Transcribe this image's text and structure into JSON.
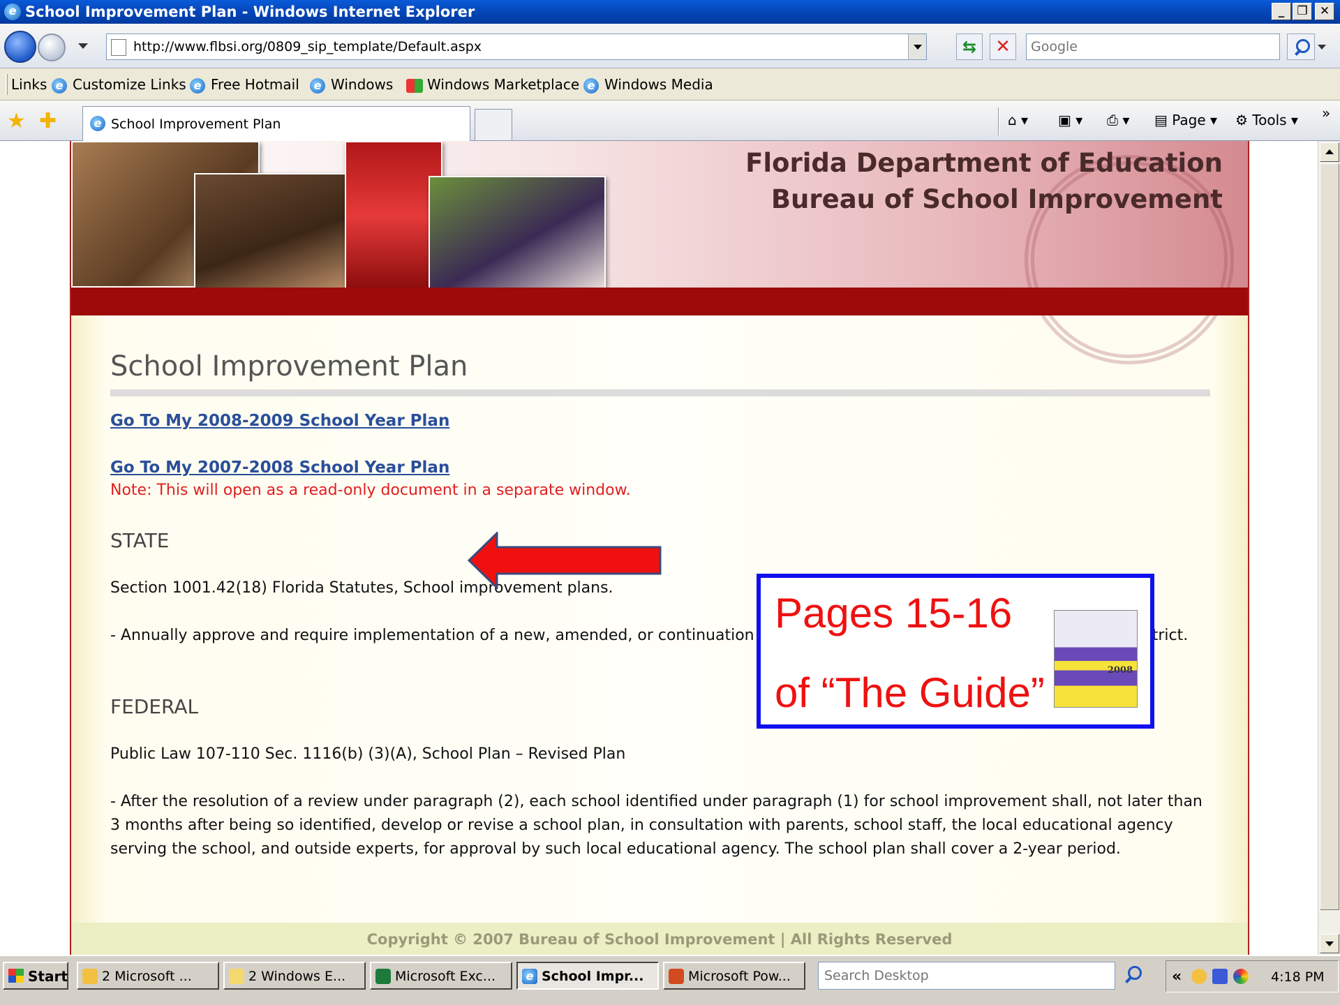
{
  "window": {
    "title": "School Improvement Plan - Windows Internet Explorer",
    "minimize": "_",
    "restore": "❐",
    "close": "✕"
  },
  "address_bar": {
    "url": "http://www.flbsi.org/0809_sip_template/Default.aspx",
    "search_placeholder": "Google"
  },
  "links_bar": {
    "label": "Links",
    "items": [
      "Customize Links",
      "Free Hotmail",
      "Windows",
      "Windows Marketplace",
      "Windows Media"
    ]
  },
  "tab_bar": {
    "active_tab": "School Improvement Plan",
    "page_menu": "Page",
    "tools_menu": "Tools",
    "more": "»"
  },
  "banner": {
    "org_line1": "Florida Department of Education",
    "org_line2": "Bureau of School Improvement"
  },
  "content": {
    "page_title": "School Improvement Plan",
    "link_2008": "Go To My 2008-2009 School Year Plan",
    "link_2007": "Go To My 2007-2008 School Year Plan",
    "note": "Note: This will open as a read-only document in a separate window.",
    "state_heading": "STATE",
    "state_citation": "Section 1001.42(18) Florida Statutes, School improvement plans.",
    "state_text": "- Annually approve and require implementation of a new, amended, or continuation school improvement plan for each school in the district.",
    "federal_heading": "FEDERAL",
    "federal_citation": "Public Law 107-110 Sec. 1116(b) (3)(A), School Plan – Revised Plan",
    "federal_text": "- After the resolution of a review under paragraph (2), each school identified under paragraph (1) for school improvement shall, not later than 3 months after being so identified, develop or revise a school plan, in consultation with parents, school staff, the local educational agency serving the school, and outside experts, for approval by such local educational agency. The school plan shall cover a 2-year period."
  },
  "callout": {
    "line1": "Pages 15-16",
    "line2": "of “The Guide”",
    "book_year": "2008"
  },
  "footer": {
    "copyright": "Copyright © 2007 Bureau of School Improvement | All Rights Reserved"
  },
  "taskbar": {
    "start": "Start",
    "buttons": [
      "2 Microsoft ...",
      "2 Windows E...",
      "Microsoft Exc...",
      "School Impr...",
      "Microsoft Pow..."
    ],
    "search_placeholder": "Search Desktop",
    "tray_chevron": "«",
    "clock": "4:18 PM"
  },
  "colors": {
    "link": "#2a4e9a",
    "note": "#e02020",
    "callout_border": "#1010ee",
    "callout_text": "#ee1111",
    "banner_stripe": "#9c0a0a"
  }
}
